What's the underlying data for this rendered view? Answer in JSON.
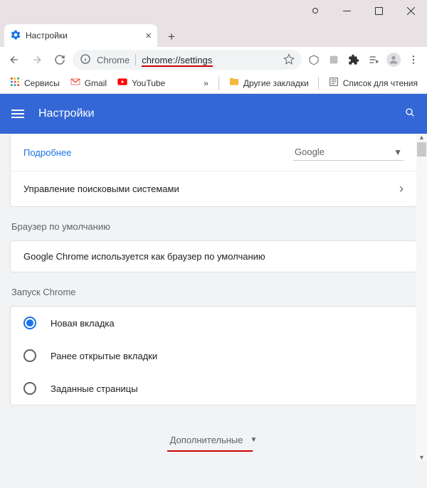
{
  "window": {
    "tab_title": "Настройки",
    "omnibox_prefix": "Chrome",
    "omnibox_url": "chrome://settings"
  },
  "bookmarks": {
    "apps": "Сервисы",
    "gmail": "Gmail",
    "youtube": "YouTube",
    "other": "Другие закладки",
    "reading": "Список для чтения"
  },
  "header": {
    "title": "Настройки"
  },
  "search_engine": {
    "learn_more": "Подробнее",
    "selected": "Google",
    "manage_label": "Управление поисковыми системами"
  },
  "default_browser": {
    "section": "Браузер по умолчанию",
    "status": "Google Chrome используется как браузер по умолчанию"
  },
  "startup": {
    "section": "Запуск Chrome",
    "options": [
      "Новая вкладка",
      "Ранее открытые вкладки",
      "Заданные страницы"
    ],
    "selected_index": 0
  },
  "advanced": {
    "label": "Дополнительные"
  }
}
